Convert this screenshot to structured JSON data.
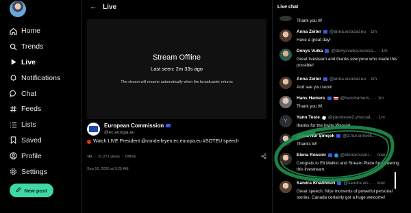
{
  "sidebar": {
    "items": [
      {
        "label": "Home",
        "icon": "home-icon"
      },
      {
        "label": "Trends",
        "icon": "search-icon"
      },
      {
        "label": "Live",
        "icon": "play-icon",
        "active": true
      },
      {
        "label": "Notifications",
        "icon": "bell-icon"
      },
      {
        "label": "Chat",
        "icon": "chat-icon"
      },
      {
        "label": "Feeds",
        "icon": "hash-icon"
      },
      {
        "label": "Lists",
        "icon": "list-icon"
      },
      {
        "label": "Saved",
        "icon": "bookmark-icon"
      },
      {
        "label": "Profile",
        "icon": "user-icon"
      },
      {
        "label": "Settings",
        "icon": "gear-icon"
      }
    ],
    "new_post": "New post"
  },
  "main": {
    "title": "Live",
    "player": {
      "status": "Stream Offline",
      "last_seen": "Last seen: 2m 33s ago",
      "note": "The stream will resume automatically when the broadcaster returns"
    },
    "author": {
      "name": "European Commission",
      "handle": "@ec.europa.eu"
    },
    "post_text": "Watch LIVE President @vonderleyen.ec.europa.eu #SOTEU speech",
    "views": "31,271 views",
    "status": "Offline",
    "date": "Sep 16, 2026 at 9:25 AM"
  },
  "chat": {
    "title": "Live chat",
    "messages": [
      {
        "name": "",
        "handle": "",
        "time": "",
        "text": "Thank you W"
      },
      {
        "name": "Anna Zeiter",
        "handle": "@anna.wsocial.eu",
        "time": "· 1m",
        "text": "Have a great day!"
      },
      {
        "name": "Denys Vuika",
        "handle": "@denysvuika.wsocia...",
        "time": "· 1m",
        "text": "Great livesteam and thanks everyone who made this possible!"
      },
      {
        "name": "Anna Zeiter",
        "handle": "@anna.wsocial.eu",
        "time": "· 1m",
        "text": "And see you soon!"
      },
      {
        "name": "Hans Hamers",
        "handle": "@hanshamers...",
        "time": "· 1m",
        "text": "Thank you W."
      },
      {
        "name": "Yann Teste",
        "handle": "@yannteste2.wsocial...",
        "time": "· 1m",
        "text": "thanks for the invite Wsocial"
      },
      {
        "name": "Zehra Nur Şimşek",
        "handle": "@z.nur.simsek...",
        "time": "",
        "text": "Thanks W!"
      },
      {
        "name": "Elena Rossini",
        "handle": "@elenarossini...",
        "time": "· now",
        "text": "Congrats to Eli Mallon and Stream Place for powering this livestream"
      },
      {
        "name": "Sandra Khadhouri",
        "handle": "@sandra.ws...",
        "time": "· now",
        "text": "Great speech. Nice moments of powerful personal stories. Canada certainly got a huge welcome!"
      }
    ]
  },
  "colors": {
    "accent": "#3fd9a4",
    "highlight": "#1f8f4e",
    "verified": "#3b5bdb",
    "live_red": "#e0321e"
  }
}
